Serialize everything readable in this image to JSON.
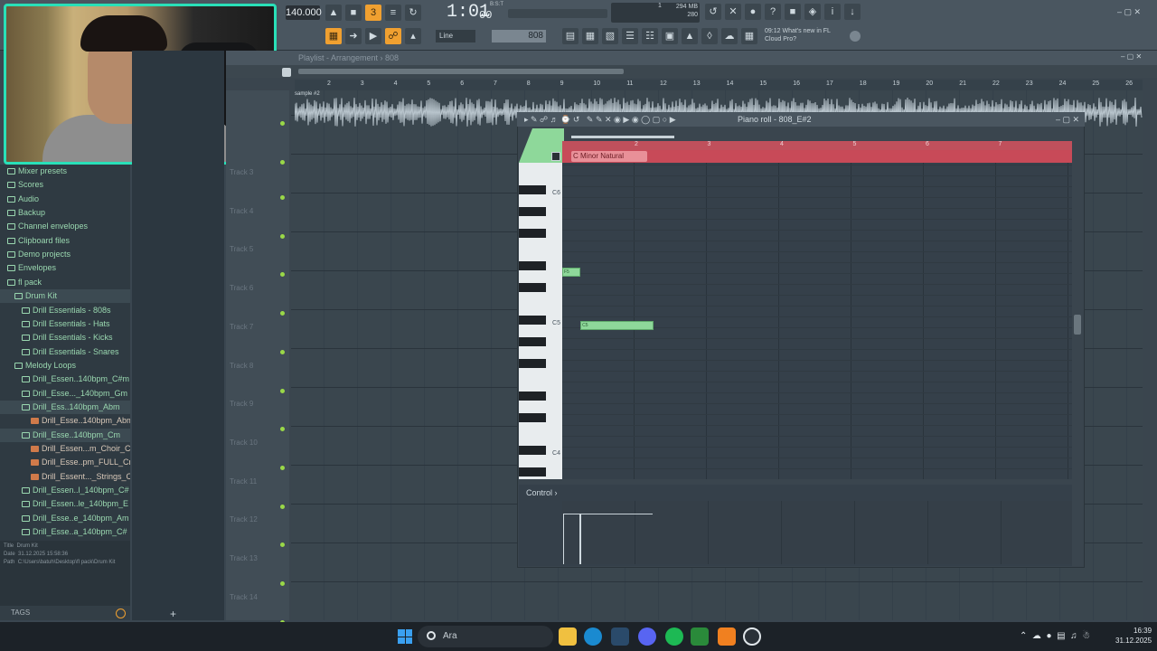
{
  "toolbar": {
    "tempo": "140.000",
    "song_position": "1:01",
    "song_position_ticks": "00",
    "bst_label": "B:S:T",
    "cpu_mb": "294 MB",
    "cpu_val": "280",
    "cpu_a": "1",
    "line_mode": "Line",
    "step_value": "808",
    "news_time": "09:12",
    "news_text": "What's new in FL",
    "news_text2": "Cloud Pro?"
  },
  "browser": {
    "items": [
      {
        "label": "Mixer presets",
        "type": "folder"
      },
      {
        "label": "Scores",
        "type": "folder"
      },
      {
        "label": "Audio",
        "type": "folder"
      },
      {
        "label": "Backup",
        "type": "folder"
      },
      {
        "label": "Channel envelopes",
        "type": "folder"
      },
      {
        "label": "Clipboard files",
        "type": "folder"
      },
      {
        "label": "Demo projects",
        "type": "folder"
      },
      {
        "label": "Envelopes",
        "type": "folder"
      },
      {
        "label": "fl pack",
        "type": "folder"
      },
      {
        "label": "Drum Kit",
        "type": "folder"
      },
      {
        "label": "Drill Essentials - 808s",
        "type": "folder"
      },
      {
        "label": "Drill Essentials - Hats",
        "type": "folder"
      },
      {
        "label": "Drill Essentials - Kicks",
        "type": "folder"
      },
      {
        "label": "Drill Essentials - Snares",
        "type": "folder"
      },
      {
        "label": "Melody Loops",
        "type": "folder"
      },
      {
        "label": "Drill_Essen..140bpm_C#m",
        "type": "folder"
      },
      {
        "label": "Drill_Esse..._140bpm_Gm",
        "type": "folder"
      },
      {
        "label": "Drill_Ess..140bpm_Abm",
        "type": "folder"
      },
      {
        "label": "Drill_Esse..140bpm_Abm",
        "type": "file"
      },
      {
        "label": "Drill_Esse..140bpm_Cm",
        "type": "folder"
      },
      {
        "label": "Drill_Essen...m_Choir_Cm",
        "type": "file"
      },
      {
        "label": "Drill_Esse..pm_FULL_Cm",
        "type": "file"
      },
      {
        "label": "Drill_Essent..._Strings_Cm",
        "type": "file"
      },
      {
        "label": "Drill_Essen..l_140bpm_C#",
        "type": "folder"
      },
      {
        "label": "Drill_Essen..le_140bpm_E",
        "type": "folder"
      },
      {
        "label": "Drill_Esse..e_140bpm_Am",
        "type": "folder"
      },
      {
        "label": "Drill_Esse..a_140bpm_C#",
        "type": "folder"
      }
    ],
    "info_title_label": "Title",
    "info_title": "Drum Kit",
    "info_date_label": "Date",
    "info_date": "31.12.2025 15:58:36",
    "info_path_label": "Path",
    "info_path": "C:\\Users\\batuh\\Desktop\\fl pack\\Drum Kit",
    "tags_label": "TAGS",
    "add_label": "+"
  },
  "playlist": {
    "title": "Playlist - Arrangement",
    "pattern": "808",
    "clip_label": "sample #2",
    "ruler": [
      "2",
      "3",
      "4",
      "5",
      "6",
      "7",
      "8",
      "9",
      "10",
      "11",
      "12",
      "13",
      "14",
      "15",
      "16",
      "17",
      "18",
      "19",
      "20",
      "21",
      "22",
      "23",
      "24",
      "25",
      "26"
    ],
    "tracks": [
      "Track 3",
      "Track 4",
      "Track 5",
      "Track 6",
      "Track 7",
      "Track 8",
      "Track 9",
      "Track 10",
      "Track 11",
      "Track 12",
      "Track 13",
      "Track 14"
    ]
  },
  "piano_roll": {
    "title": "Piano roll - 808_E#2",
    "scale": "C Minor Natural (Aeolian)",
    "ruler": [
      "2",
      "3",
      "4",
      "5",
      "6",
      "7"
    ],
    "key_labels": [
      "C6",
      "C5",
      "C4"
    ],
    "notes": [
      {
        "label": "F5",
        "start": 0,
        "length": 0.25
      },
      {
        "label": "C5",
        "start": 0.25,
        "length": 1.0
      }
    ],
    "control_label": "Control"
  },
  "taskbar": {
    "search_placeholder": "Ara",
    "time": "16:39",
    "date": "31.12.2025"
  }
}
